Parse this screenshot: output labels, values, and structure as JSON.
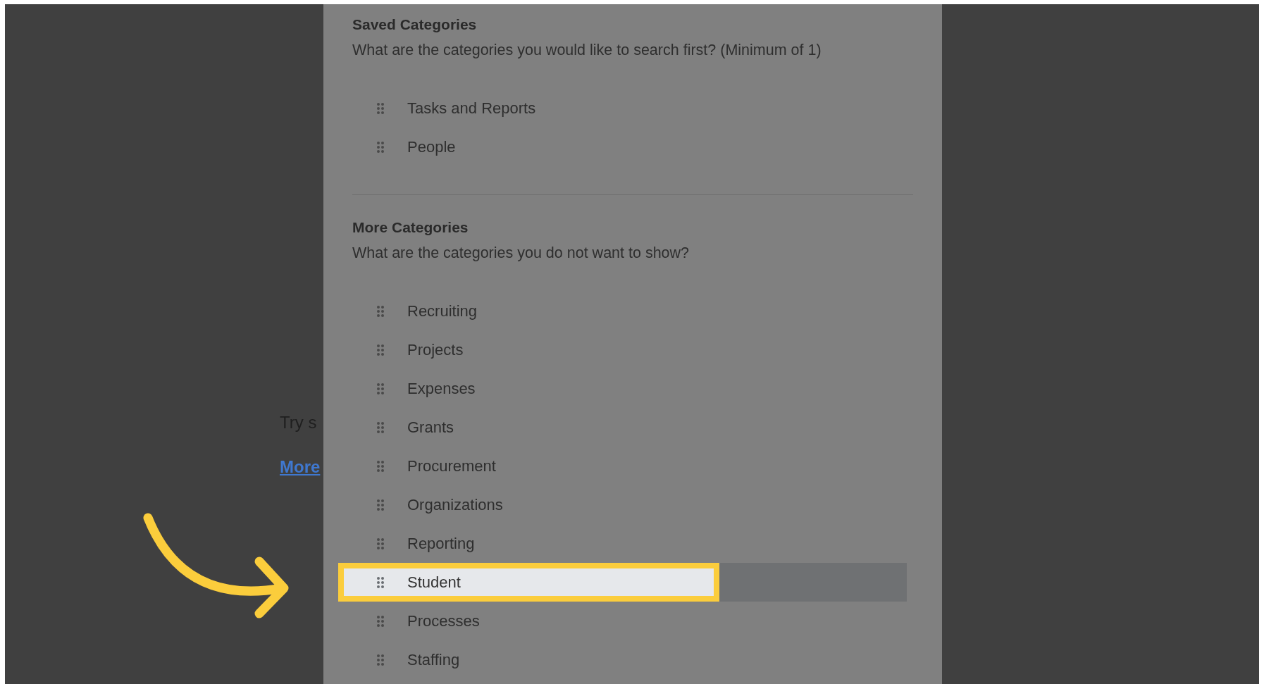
{
  "background": {
    "hint_text": "Try s",
    "link": "More"
  },
  "saved_categories": {
    "title": "Saved Categories",
    "description": "What are the categories you would like to search first? (Minimum of 1)",
    "items": [
      {
        "label": "Tasks and Reports",
        "selected": false
      },
      {
        "label": "People",
        "selected": false
      }
    ]
  },
  "more_categories": {
    "title": "More Categories",
    "description": "What are the categories you do not want to show?",
    "items": [
      {
        "label": "Recruiting",
        "selected": false
      },
      {
        "label": "Projects",
        "selected": false
      },
      {
        "label": "Expenses",
        "selected": false
      },
      {
        "label": "Grants",
        "selected": false
      },
      {
        "label": "Procurement",
        "selected": false
      },
      {
        "label": "Organizations",
        "selected": false
      },
      {
        "label": "Reporting",
        "selected": false
      },
      {
        "label": "Student",
        "selected": true
      },
      {
        "label": "Processes",
        "selected": false
      },
      {
        "label": "Staffing",
        "selected": false
      }
    ]
  }
}
